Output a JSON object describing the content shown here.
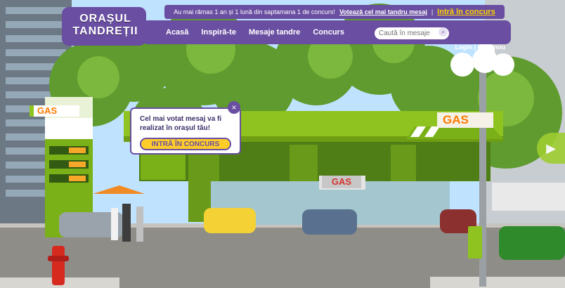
{
  "logo": {
    "line1": "ORAȘUL",
    "line2": "TANDREȚII"
  },
  "topbar": {
    "notice": "Au mai rămas 1 an și 1 lună din saptamana 1 de concurs!",
    "vote_link": "Votează cel mai tandru mesaj",
    "separator": "|",
    "cta_link": "Intră în concurs"
  },
  "nav": {
    "items": [
      "Acasă",
      "Inspiră-te",
      "Mesaje tandre",
      "Concurs"
    ],
    "search_placeholder": "Caută în mesaje"
  },
  "account": {
    "login": "Login",
    "separator": "|",
    "create": "Cont nou"
  },
  "callout": {
    "text": "Cel mai votat mesaj va fi realizat în orașul tău!",
    "button": "INTRĂ ÎN CONCURS",
    "close": "×"
  },
  "scene_signs": {
    "gas_left": "GAS",
    "gas_right": "GAS",
    "gas_center": "GAS"
  },
  "colors": {
    "purple": "#6a4ea1",
    "yellow": "#ffcd2a",
    "lime": "#8fc31f"
  }
}
